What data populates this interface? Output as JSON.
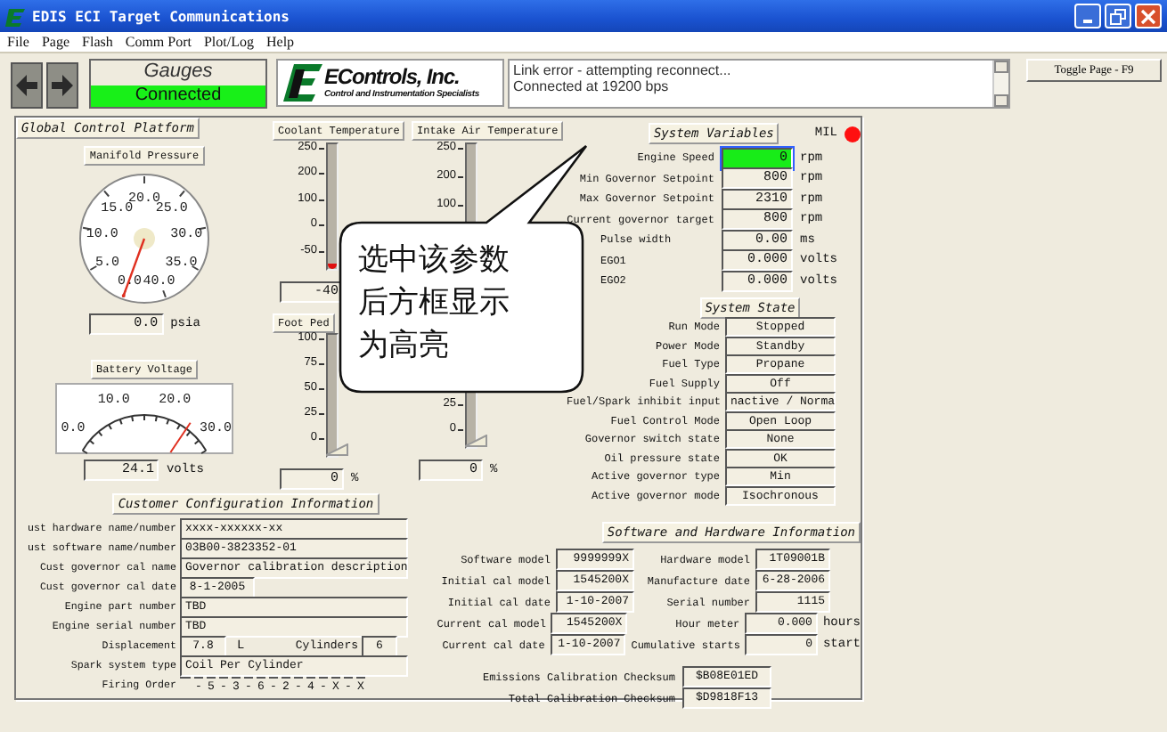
{
  "window": {
    "title": "EDIS ECI Target Communications"
  },
  "menu": [
    "File",
    "Page",
    "Flash",
    "Comm Port",
    "Plot/Log",
    "Help"
  ],
  "toolbar": {
    "page_name": "Gauges",
    "connection": "Connected",
    "connected": true,
    "logo_name": "EControls, Inc.",
    "logo_tagline": "Control and Instrumentation Specialists",
    "log": [
      "Link error - attempting reconnect...",
      "Connected at 19200 bps"
    ],
    "toggle_button": "Toggle Page - F9"
  },
  "platform_title": "Global Control Platform",
  "dial_gauges": [
    {
      "kind": "round",
      "title": "Manifold Pressure",
      "scale": [
        "20.0",
        "15.0",
        "25.0",
        "10.0",
        "30.0",
        "5.0",
        "35.0",
        "0.0",
        "40.0"
      ],
      "level": 0,
      "value": "0.0",
      "unit": "psia"
    },
    {
      "kind": "arc",
      "title": "Battery Voltage",
      "scale": [
        "0.0",
        "10.0",
        "20.0",
        "30.0"
      ],
      "level": 0.8,
      "value": "24.1",
      "unit": "volts"
    }
  ],
  "bar_gauges": [
    {
      "kind": "temperature",
      "title": "Coolant Temperature",
      "ticks": [
        "250",
        "200",
        "100",
        "0",
        "-50"
      ],
      "level": 0.04,
      "value": "-40"
    },
    {
      "kind": "temperature",
      "title": "Intake Air Temperature",
      "ticks": [
        "250",
        "200",
        "100"
      ]
    },
    {
      "kind": "pedal",
      "title": "Foot Ped",
      "ticks": [
        "100",
        "75",
        "50",
        "25",
        "0"
      ],
      "level": 0,
      "value": "0",
      "unit": "%"
    },
    {
      "kind": "pedal",
      "ticks": [
        "25",
        "0"
      ],
      "level": 0,
      "value": "0",
      "unit": "%"
    }
  ],
  "system_variables": {
    "title": "System Variables",
    "mil_label": "MIL",
    "mil_on": true,
    "rows": [
      {
        "label": "Engine Speed",
        "value": "0",
        "unit": "rpm",
        "selected": true
      },
      {
        "label": "Min Governor Setpoint",
        "value": "800",
        "unit": "rpm",
        "selected": false
      },
      {
        "label": "Max Governor Setpoint",
        "value": "2310",
        "unit": "rpm",
        "selected": false
      },
      {
        "label": "Current governor target",
        "value": "800",
        "unit": "rpm",
        "selected": false
      },
      {
        "label": "Pulse width",
        "value": "0.00",
        "unit": "ms",
        "selected": false
      },
      {
        "label": "EGO1",
        "value": "0.000",
        "unit": "volts",
        "selected": false
      },
      {
        "label": "EGO2",
        "value": "0.000",
        "unit": "volts",
        "selected": false
      }
    ]
  },
  "system_state": {
    "title": "System State",
    "rows": [
      {
        "label": "Run Mode",
        "value": "Stopped"
      },
      {
        "label": "Power Mode",
        "value": "Standby"
      },
      {
        "label": "Fuel Type",
        "value": "Propane"
      },
      {
        "label": "Fuel Supply",
        "value": "Off"
      },
      {
        "label": "Fuel/Spark inhibit input",
        "value": "nactive / Norma"
      },
      {
        "label": "Fuel Control Mode",
        "value": "Open Loop"
      },
      {
        "label": "Governor switch state",
        "value": "None"
      },
      {
        "label": "Oil pressure state",
        "value": "OK"
      },
      {
        "label": "Active governor type",
        "value": "Min"
      },
      {
        "label": "Active governor mode",
        "value": "Isochronous"
      }
    ]
  },
  "customer_config": {
    "title": "Customer Configuration Information",
    "rows": [
      {
        "kind": "text",
        "label": "ust hardware name/number",
        "value": "xxxx-xxxxxx-xx"
      },
      {
        "kind": "text",
        "label": "ust software name/number",
        "value": "03B00-3823352-01"
      },
      {
        "kind": "text",
        "label": "Cust governor cal name",
        "value": "Governor calibration description"
      },
      {
        "kind": "short",
        "label": "Cust governor cal date",
        "value": "8-1-2005"
      },
      {
        "kind": "text",
        "label": "Engine part number",
        "value": "TBD"
      },
      {
        "kind": "text",
        "label": "Engine serial number",
        "value": "TBD"
      },
      {
        "kind": "split",
        "label": "Displacement",
        "value": "7.8",
        "unit": "L",
        "label2": "Cylinders",
        "value2": "6"
      },
      {
        "kind": "text",
        "label": "Spark system type",
        "value": "Coil Per Cylinder"
      },
      {
        "kind": "sequence",
        "label": "Firing Order",
        "values": [
          "-",
          "5",
          "-",
          "3",
          "-",
          "6",
          "-",
          "2",
          "-",
          "4",
          "-",
          "X",
          "-",
          "X"
        ]
      }
    ]
  },
  "software_hardware": {
    "title": "Software and Hardware Information",
    "rows": [
      {
        "label": "Software model",
        "value": "9999999X",
        "label2": "Hardware model",
        "value2": "1T09001B"
      },
      {
        "label": "Initial cal model",
        "value": "1545200X",
        "label2": "Manufacture date",
        "value2": "6-28-2006"
      },
      {
        "label": "Initial cal date",
        "value": "1-10-2007",
        "label2": "Serial number",
        "value2": "1115"
      },
      {
        "label": "Current cal model",
        "value": "1545200X",
        "label2": "Hour meter",
        "value2": "0.000",
        "unit2": "hours"
      },
      {
        "label": "Current cal date",
        "value": "1-10-2007",
        "label2": "Cumulative starts",
        "value2": "0",
        "unit2": "start"
      }
    ],
    "checksums": [
      {
        "label": "Emissions Calibration Checksum",
        "value": "$B08E01ED"
      },
      {
        "label": "Total Calibration Checksum",
        "value": "$D9818F13"
      }
    ]
  },
  "callout": {
    "text": "选中该参数后方框显示为高亮"
  }
}
